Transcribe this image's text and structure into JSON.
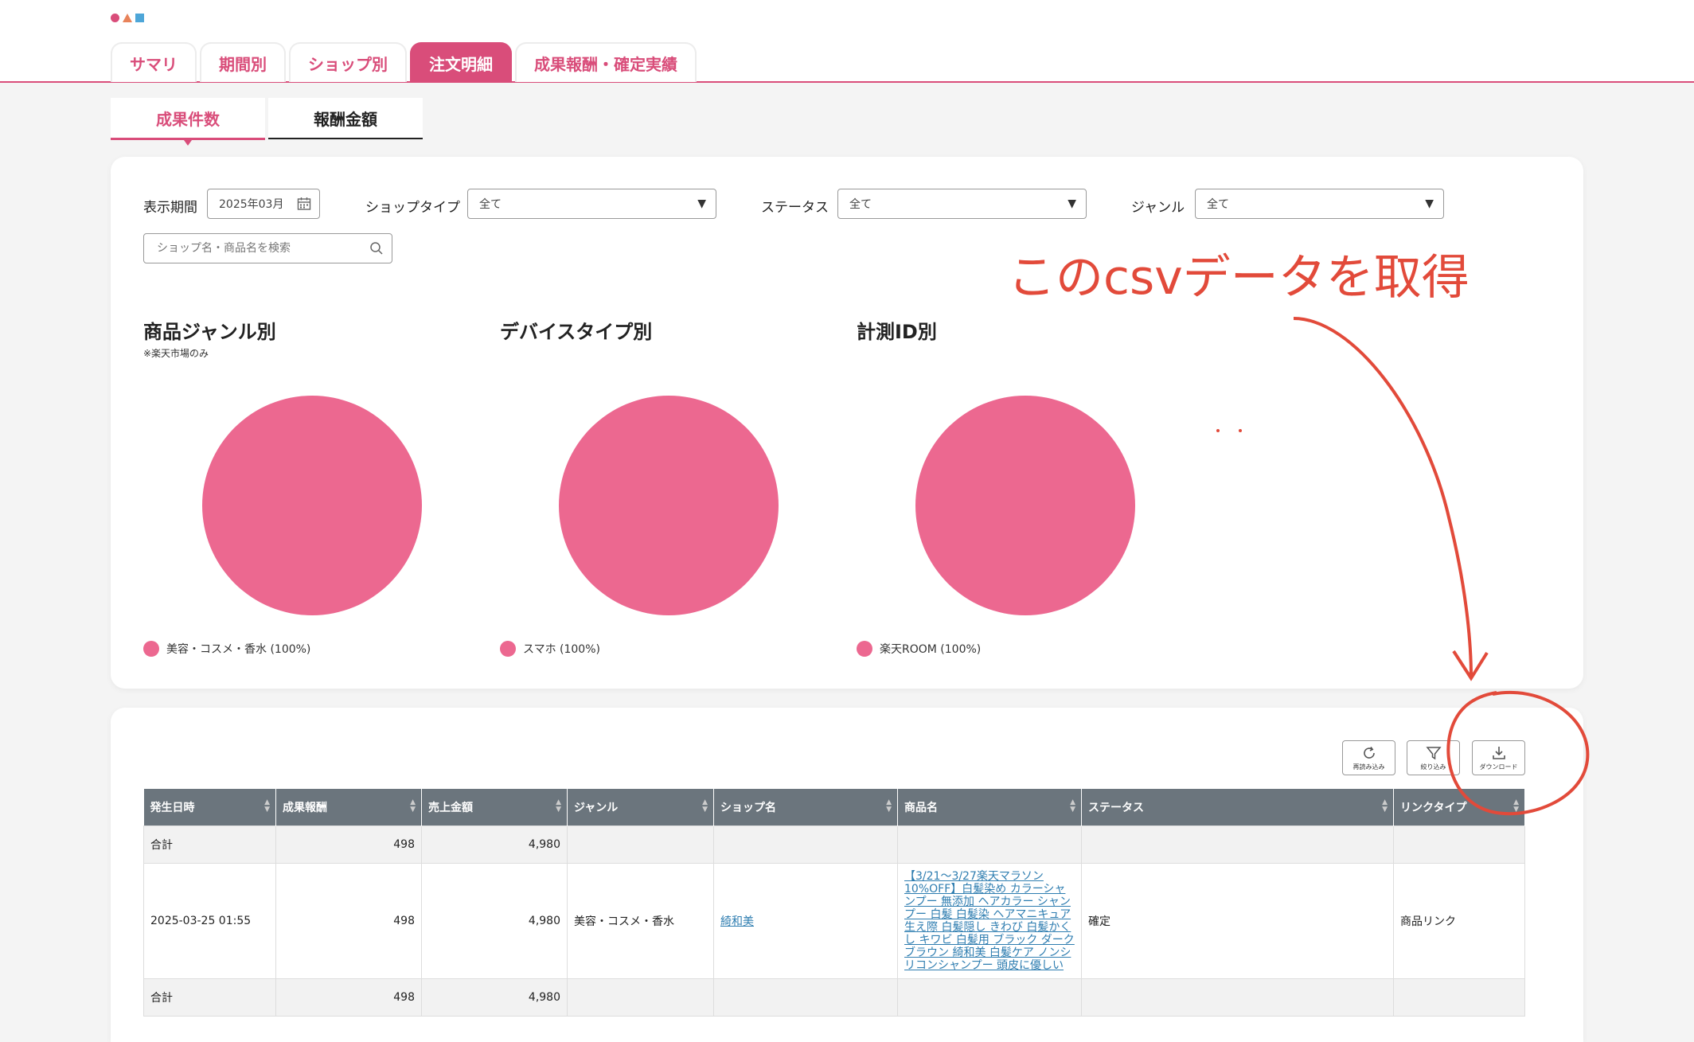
{
  "tabs": [
    "サマリ",
    "期間別",
    "ショップ別",
    "注文明細",
    "成果報酬・確定実績"
  ],
  "subtabs": [
    "成果件数",
    "報酬金額"
  ],
  "filters": {
    "period_label": "表示期間",
    "period_value": "2025年03月",
    "shoptype_label": "ショップタイプ",
    "shoptype_value": "全て",
    "status_label": "ステータス",
    "status_value": "全て",
    "genre_label": "ジャンル",
    "genre_value": "全て",
    "search_placeholder": "ショップ名・商品名を検索"
  },
  "charts": [
    {
      "title": "商品ジャンル別",
      "note": "※楽天市場のみ",
      "legend": "美容・コスメ・香水 (100%)",
      "color": "#ec6890"
    },
    {
      "title": "デバイスタイプ別",
      "note": "",
      "legend": "スマホ (100%)",
      "color": "#ec6890"
    },
    {
      "title": "計測ID別",
      "note": "",
      "legend": "楽天ROOM (100%)",
      "color": "#ec6890"
    }
  ],
  "chart_data": [
    {
      "type": "pie",
      "title": "商品ジャンル別",
      "labels": [
        "美容・コスメ・香水"
      ],
      "values": [
        100
      ]
    },
    {
      "type": "pie",
      "title": "デバイスタイプ別",
      "labels": [
        "スマホ"
      ],
      "values": [
        100
      ]
    },
    {
      "type": "pie",
      "title": "計測ID別",
      "labels": [
        "楽天ROOM"
      ],
      "values": [
        100
      ]
    }
  ],
  "annotation": {
    "text": "このcsvデータを取得",
    "color": "#e24a3a"
  },
  "toolbar": {
    "reload": "再読み込み",
    "filter": "絞り込み",
    "download": "ダウンロード"
  },
  "table": {
    "headers": [
      "発生日時",
      "成果報酬",
      "売上金額",
      "ジャンル",
      "ショップ名",
      "商品名",
      "ステータス",
      "リンクタイプ"
    ],
    "total_top": {
      "label": "合計",
      "reward": "498",
      "sales": "4,980"
    },
    "row": {
      "date": "2025-03-25 01:55",
      "reward": "498",
      "sales": "4,980",
      "genre": "美容・コスメ・香水",
      "shop": "綺和美",
      "product": "【3/21〜3/27楽天マラソン10%OFF】白髪染め カラーシャンプー 無添加 ヘアカラー シャンプー 白髪 白髪染 ヘアマニキュア 生え際 白髪隠し きわび 白髪かくし キワビ 白髪用 ブラック ダークブラウン 綺和美 白髪ケア ノンシリコンシャンプー 頭皮に優しい",
      "status": "確定",
      "linktype": "商品リンク"
    },
    "total_bottom": {
      "label": "合計",
      "reward": "498",
      "sales": "4,980"
    }
  }
}
